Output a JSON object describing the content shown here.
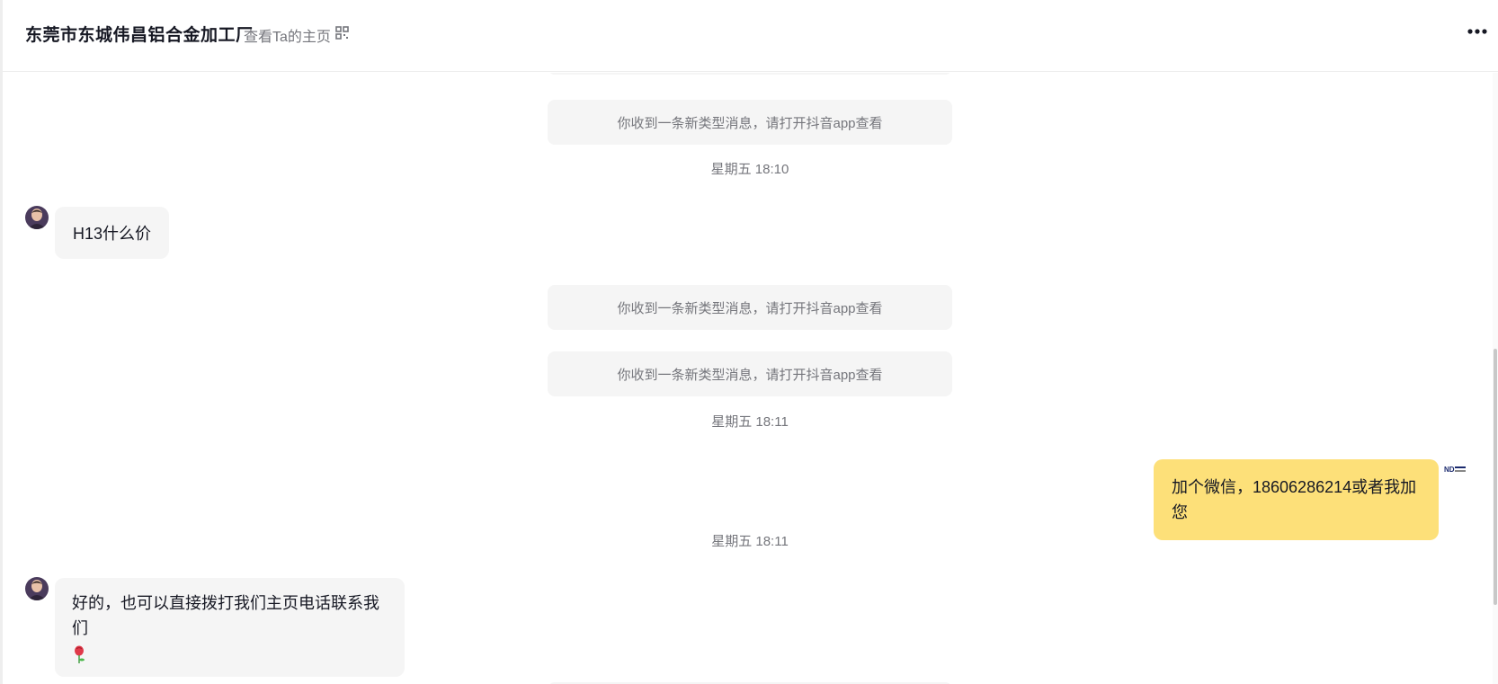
{
  "header": {
    "title": "东莞市东城伟昌铝合金加工厂",
    "profile_link": "查看Ta的主页"
  },
  "messages": {
    "system_notice": "你收到一条新类型消息，请打开抖音app查看",
    "time_1": "星期五 18:10",
    "incoming_1": "H13什么价",
    "time_2": "星期五 18:11",
    "outgoing_1": "加个微信，18606286214或者我加您",
    "time_3": "星期五 18:11",
    "incoming_2": "好的，也可以直接拨打我们主页电话联系我们"
  },
  "self_avatar_label": "ND",
  "colors": {
    "outgoing_bubble": "#fde079",
    "incoming_bubble": "#f5f5f5",
    "secondary_text": "#75767c"
  },
  "icons": {
    "profile_qr": "qr-code-icon",
    "more": "more-dots-icon",
    "emoji": "rose-emoji"
  }
}
